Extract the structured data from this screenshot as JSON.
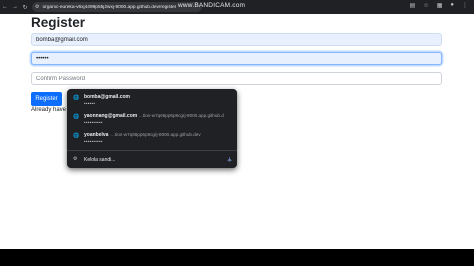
{
  "browser": {
    "url": "organic-eureka-v6xj4499p55j2wxj-8000.app.github.dev/register",
    "watermark": "www.BANDICAM.com",
    "icons": [
      "back-icon",
      "forward-icon",
      "reload-icon",
      "tune-icon",
      "translate-icon",
      "star-icon",
      "extensions-icon",
      "profile-icon",
      "menu-icon"
    ]
  },
  "page": {
    "title": "Register",
    "email_value": "bomba@gmail.com",
    "password_value": "••••••",
    "confirm_placeholder": "Confirm Password",
    "register_label": "Register",
    "already_text": "Already have a"
  },
  "autofill": {
    "items": [
      {
        "user": "bomba@gmail.com",
        "site": "",
        "password": "••••••"
      },
      {
        "user": "yaonnang@gmail.com",
        "site": "...tion-w7q66pp6p9cgrj-8000.app.github.d",
        "password": "••••••••••"
      },
      {
        "user": "yoanbelva",
        "site": "...tion-w7q66pp6p9cgrj-8000.app.github.dev",
        "password": "••••••••••"
      }
    ],
    "manage_label": "Kelola sandi...",
    "icons": [
      "globe-icon",
      "key-icon"
    ]
  },
  "colors": {
    "primary": "#0d6efd",
    "autofill_bg": "#202124",
    "filled_input_bg": "#e8f0fe"
  }
}
